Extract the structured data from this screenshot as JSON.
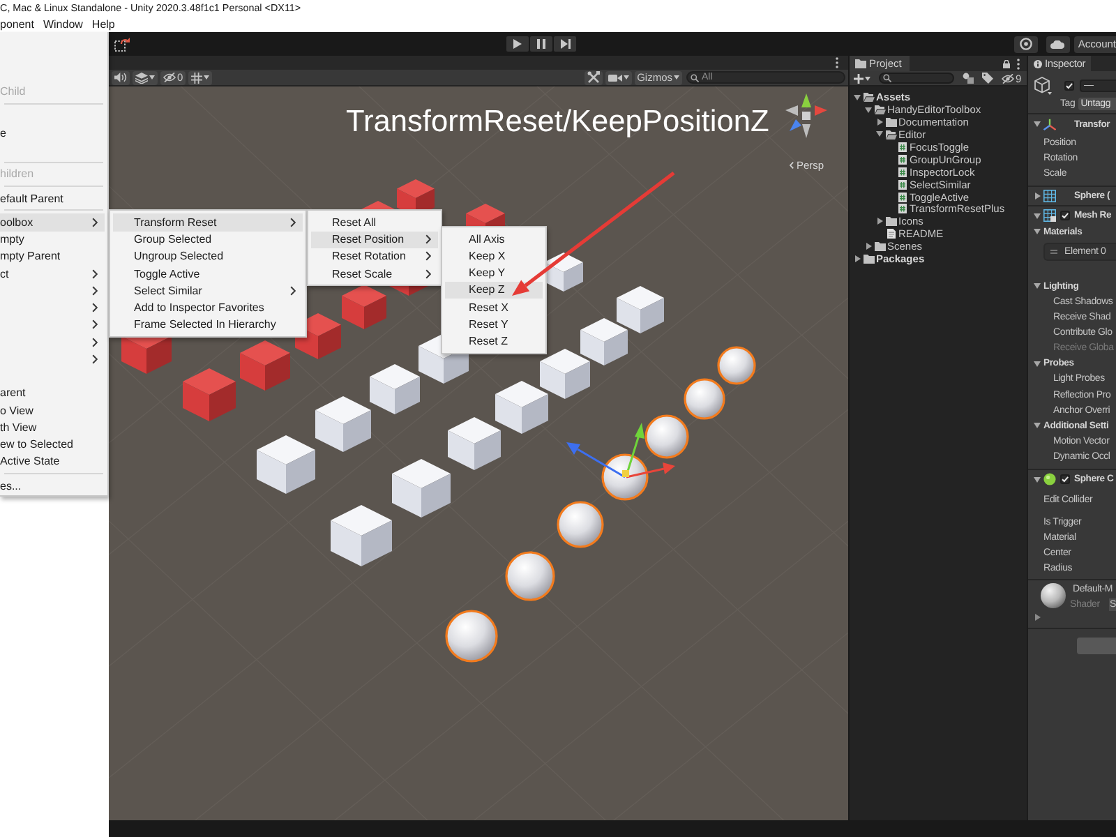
{
  "window": {
    "title": "C, Mac & Linux Standalone - Unity 2020.3.48f1c1 Personal <DX11>"
  },
  "menu_bar": [
    "ponent",
    "Window",
    "Help"
  ],
  "toolbar": {
    "account": "Account"
  },
  "scene": {
    "toolbar": {
      "hidden_count": "0",
      "gizmos": "Gizmos",
      "search_placeholder": "All"
    },
    "annotation": "TransformReset/KeepPositionZ",
    "projection": "Persp"
  },
  "menus": [
    {
      "items": [
        {
          "kind": "item",
          "submenu": false,
          "selected": false
        },
        {
          "kind": "item",
          "submenu": false,
          "selected": false
        },
        {
          "kind": "item",
          "submenu": false,
          "selected": false
        },
        {
          "kind": "item",
          "label": "Child",
          "submenu": false,
          "disabled": true,
          "selected": false
        },
        {
          "kind": "separator"
        },
        {
          "kind": "item",
          "submenu": false,
          "selected": false
        },
        {
          "kind": "item",
          "label": "e",
          "submenu": false,
          "disabled": false,
          "selected": false
        },
        {
          "kind": "item",
          "submenu": false,
          "selected": false
        },
        {
          "kind": "separator"
        },
        {
          "kind": "item",
          "label": "hildren",
          "submenu": false,
          "disabled": true,
          "selected": false
        },
        {
          "kind": "separator"
        },
        {
          "kind": "item",
          "label": "efault Parent",
          "submenu": false,
          "disabled": false,
          "selected": false
        },
        {
          "kind": "separator"
        },
        {
          "kind": "item",
          "label": "oolbox",
          "submenu": true,
          "disabled": false,
          "selected": true
        },
        {
          "kind": "item",
          "label": "mpty",
          "submenu": false,
          "disabled": false,
          "selected": false
        },
        {
          "kind": "item",
          "label": "mpty Parent",
          "submenu": false,
          "disabled": false,
          "selected": false
        },
        {
          "kind": "item",
          "label": "ct",
          "submenu": true,
          "disabled": false,
          "selected": false
        },
        {
          "kind": "item",
          "submenu": true,
          "disabled": false,
          "selected": false
        },
        {
          "kind": "item",
          "submenu": true,
          "disabled": false,
          "selected": false
        },
        {
          "kind": "item",
          "submenu": true,
          "disabled": false,
          "selected": false
        },
        {
          "kind": "item",
          "submenu": true,
          "disabled": false,
          "selected": false
        },
        {
          "kind": "item",
          "submenu": true,
          "disabled": false,
          "selected": false
        },
        {
          "kind": "item",
          "submenu": false,
          "selected": false
        },
        {
          "kind": "item",
          "label": "arent",
          "submenu": false,
          "disabled": false,
          "selected": false
        },
        {
          "kind": "item",
          "label": "o View",
          "submenu": false,
          "disabled": false,
          "selected": false
        },
        {
          "kind": "item",
          "label": "th View",
          "submenu": false,
          "disabled": false,
          "selected": false
        },
        {
          "kind": "item",
          "label": "ew to Selected",
          "submenu": false,
          "disabled": false,
          "selected": false
        },
        {
          "kind": "item",
          "label": "Active State",
          "submenu": false,
          "disabled": false,
          "selected": false
        },
        {
          "kind": "separator"
        },
        {
          "kind": "item",
          "label": "es...",
          "submenu": false,
          "disabled": false,
          "selected": false
        }
      ]
    },
    {
      "items": [
        {
          "kind": "item",
          "label": "Transform Reset",
          "submenu": true,
          "disabled": false,
          "selected": true
        },
        {
          "kind": "item",
          "label": "Group Selected",
          "submenu": false,
          "disabled": false,
          "selected": false
        },
        {
          "kind": "item",
          "label": "Ungroup Selected",
          "submenu": false,
          "disabled": false,
          "selected": false
        },
        {
          "kind": "item",
          "label": "Toggle Active",
          "submenu": false,
          "disabled": false,
          "selected": false
        },
        {
          "kind": "item",
          "label": "Select Similar",
          "submenu": true,
          "disabled": false,
          "selected": false
        },
        {
          "kind": "item",
          "label": "Add to Inspector Favorites",
          "submenu": false,
          "disabled": false,
          "selected": false
        },
        {
          "kind": "item",
          "label": "Frame Selected In Hierarchy",
          "submenu": false,
          "disabled": false,
          "selected": false
        }
      ]
    },
    {
      "items": [
        {
          "kind": "item",
          "label": "Reset All",
          "submenu": false,
          "disabled": false,
          "selected": false
        },
        {
          "kind": "item",
          "label": "Reset Position",
          "submenu": true,
          "disabled": false,
          "selected": true
        },
        {
          "kind": "item",
          "label": "Reset Rotation",
          "submenu": true,
          "disabled": false,
          "selected": false
        },
        {
          "kind": "item",
          "label": "Reset Scale",
          "submenu": true,
          "disabled": false,
          "selected": false
        }
      ]
    },
    {
      "items": [
        {
          "kind": "item",
          "label": "All Axis",
          "submenu": false,
          "disabled": false,
          "selected": false
        },
        {
          "kind": "item",
          "label": "Keep X",
          "submenu": false,
          "disabled": false,
          "selected": false
        },
        {
          "kind": "item",
          "label": "Keep Y",
          "submenu": false,
          "disabled": false,
          "selected": false
        },
        {
          "kind": "item",
          "label": "Keep Z",
          "submenu": false,
          "disabled": false,
          "selected": true
        },
        {
          "kind": "item",
          "label": "Reset X",
          "submenu": false,
          "disabled": false,
          "selected": false
        },
        {
          "kind": "item",
          "label": "Reset Y",
          "submenu": false,
          "disabled": false,
          "selected": false
        },
        {
          "kind": "item",
          "label": "Reset Z",
          "submenu": false,
          "disabled": false,
          "selected": false
        }
      ]
    }
  ],
  "project": {
    "tab": "Project",
    "hidden_count": "9",
    "tree": [
      {
        "label": "Assets",
        "kind": "folder",
        "expanded": true,
        "children": [
          {
            "label": "HandyEditorToolbox",
            "kind": "folder",
            "expanded": true,
            "children": [
              {
                "label": "Documentation",
                "kind": "folder",
                "expanded": false
              },
              {
                "label": "Editor",
                "kind": "folder",
                "expanded": true,
                "children": [
                  {
                    "label": "FocusToggle",
                    "kind": "script"
                  },
                  {
                    "label": "GroupUnGroup",
                    "kind": "script"
                  },
                  {
                    "label": "InspectorLock",
                    "kind": "script"
                  },
                  {
                    "label": "SelectSimilar",
                    "kind": "script"
                  },
                  {
                    "label": "ToggleActive",
                    "kind": "script"
                  },
                  {
                    "label": "TransformResetPlus",
                    "kind": "script"
                  }
                ]
              },
              {
                "label": "Icons",
                "kind": "folder",
                "expanded": false
              },
              {
                "label": "README",
                "kind": "document"
              }
            ]
          },
          {
            "label": "Scenes",
            "kind": "folder",
            "expanded": false
          }
        ]
      },
      {
        "label": "Packages",
        "kind": "folder",
        "expanded": false
      }
    ]
  },
  "inspector": {
    "tab": "Inspector",
    "object": {
      "active": true,
      "name": "—",
      "tag_label": "Tag",
      "tag": "Untagg"
    },
    "components": [
      {
        "kind": "transform",
        "title": "Transfor",
        "expanded": true,
        "rows": [
          {
            "kind": "field",
            "label": "Position"
          },
          {
            "kind": "field",
            "label": "Rotation"
          },
          {
            "kind": "field",
            "label": "Scale"
          }
        ]
      },
      {
        "kind": "mesh_filter",
        "title": "Sphere (",
        "expanded": false
      },
      {
        "kind": "mesh_renderer",
        "title": "Mesh Re",
        "enabled": true,
        "expanded": true,
        "sections": [
          {
            "title": "Materials",
            "expanded": true,
            "rows": [
              {
                "kind": "element",
                "label": "Element 0"
              }
            ]
          },
          {
            "title": "Lighting",
            "expanded": true,
            "rows": [
              {
                "kind": "field",
                "label": "Cast Shadows",
                "disabled": false
              },
              {
                "kind": "field",
                "label": "Receive Shad",
                "disabled": false
              },
              {
                "kind": "field",
                "label": "Contribute Glo",
                "disabled": false
              },
              {
                "kind": "field",
                "label": "Receive Globa",
                "disabled": true
              }
            ]
          },
          {
            "title": "Probes",
            "expanded": true,
            "rows": [
              {
                "kind": "field",
                "label": "Light Probes"
              },
              {
                "kind": "field",
                "label": "Reflection Pro"
              },
              {
                "kind": "field",
                "label": "Anchor Overri"
              }
            ]
          },
          {
            "title": "Additional Setti",
            "expanded": true,
            "rows": [
              {
                "kind": "field",
                "label": "Motion Vector"
              },
              {
                "kind": "field",
                "label": "Dynamic Occl"
              }
            ]
          }
        ]
      },
      {
        "kind": "sphere_collider",
        "title": "Sphere C",
        "enabled": true,
        "expanded": true,
        "rows": [
          {
            "kind": "tool",
            "label": "Edit Collider"
          },
          {
            "kind": "field",
            "label": "Is Trigger"
          },
          {
            "kind": "field",
            "label": "Material"
          },
          {
            "kind": "field",
            "label": "Center"
          },
          {
            "kind": "field",
            "label": "Radius"
          }
        ]
      }
    ],
    "material": {
      "name": "Default-M",
      "shader_label": "Shader",
      "shader": "S",
      "expanded": false
    }
  }
}
